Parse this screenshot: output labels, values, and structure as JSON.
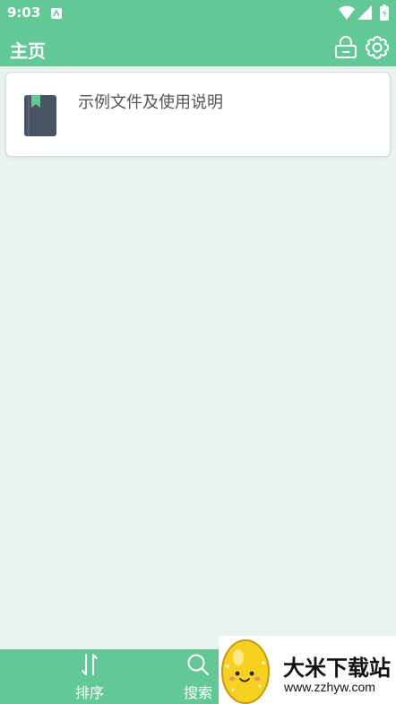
{
  "status_bar": {
    "time": "9:03",
    "icons": [
      "app-notification-icon",
      "wifi-icon",
      "signal-icon",
      "battery-icon"
    ]
  },
  "app_bar": {
    "title": "主页",
    "actions": [
      "lock-icon",
      "settings-gear-icon"
    ]
  },
  "files": [
    {
      "name": "示例文件及使用说明",
      "icon": "book-icon"
    }
  ],
  "bottom_nav": {
    "items": [
      {
        "label": "排序",
        "icon": "sort-arrows-icon"
      },
      {
        "label": "搜索",
        "icon": "search-icon"
      }
    ]
  },
  "watermark": {
    "title": "大米下载站",
    "url": "www.zzhyw.com"
  },
  "colors": {
    "primary": "#62c996",
    "background": "#e9f4ee",
    "card": "#ffffff",
    "book": "#4a5563",
    "bookmark": "#62c996"
  }
}
